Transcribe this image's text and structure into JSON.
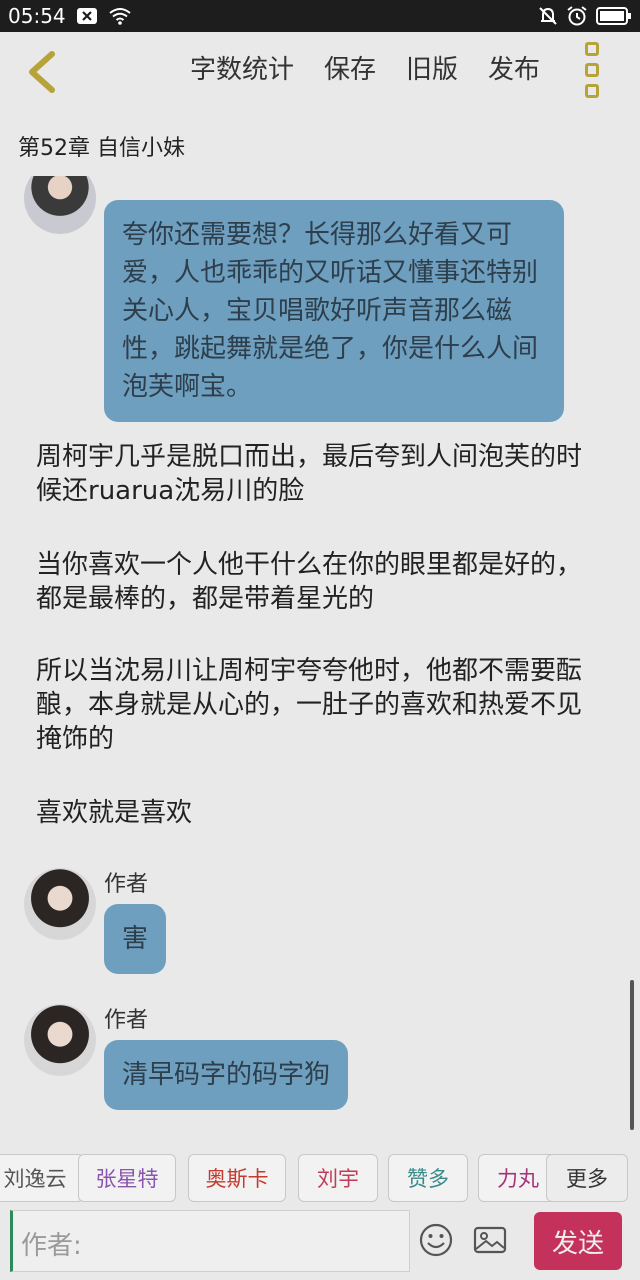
{
  "status_bar": {
    "time": "05:54",
    "icons": [
      "notification-close-icon",
      "wifi-icon",
      "mute-bell-icon",
      "alarm-icon",
      "battery-icon"
    ]
  },
  "header": {
    "back_icon": "chevron-left-icon",
    "actions": [
      "字数统计",
      "保存",
      "旧版",
      "发布"
    ],
    "more_icon": "more-vertical-icon",
    "accent_color": "#b6a33a"
  },
  "chapter_title": "第52章 自信小妹",
  "messages": [
    {
      "type": "bubble",
      "text": "夸你还需要想？长得那么好看又可爱，人也乖乖的又听话又懂事还特别关心人，宝贝唱歌好听声音那么磁性，跳起舞就是绝了，你是什么人间泡芙啊宝。"
    },
    {
      "type": "para",
      "text": "周柯宇几乎是脱口而出，最后夸到人间泡芙的时候还ruarua沈易川的脸"
    },
    {
      "type": "para",
      "text": "当你喜欢一个人他干什么在你的眼里都是好的，都是最棒的，都是带着星光的"
    },
    {
      "type": "para",
      "text": "所以当沈易川让周柯宇夸夸他时，他都不需要酝酿，本身就是从心的，一肚子的喜欢和热爱不见掩饰的"
    },
    {
      "type": "para",
      "text": "喜欢就是喜欢"
    },
    {
      "type": "bubble",
      "sender": "作者",
      "text": "害"
    },
    {
      "type": "bubble",
      "sender": "作者",
      "text": "清早码字的码字狗"
    }
  ],
  "quick_tags": [
    {
      "label": "刘逸云",
      "color": "#555555"
    },
    {
      "label": "张星特",
      "color": "#8a55b0"
    },
    {
      "label": "奥斯卡",
      "color": "#c43a2e"
    },
    {
      "label": "刘宇",
      "color": "#c23a5a"
    },
    {
      "label": "赞多",
      "color": "#3a8a8a"
    },
    {
      "label": "力丸",
      "color": "#a6327a"
    }
  ],
  "more_tags_label": "更多",
  "composer": {
    "placeholder": "作者:",
    "emoji_icon": "emoji-icon",
    "image_icon": "image-icon",
    "send_label": "发送",
    "send_color": "#c4325b"
  },
  "bubble_color": "#6f9fbf"
}
